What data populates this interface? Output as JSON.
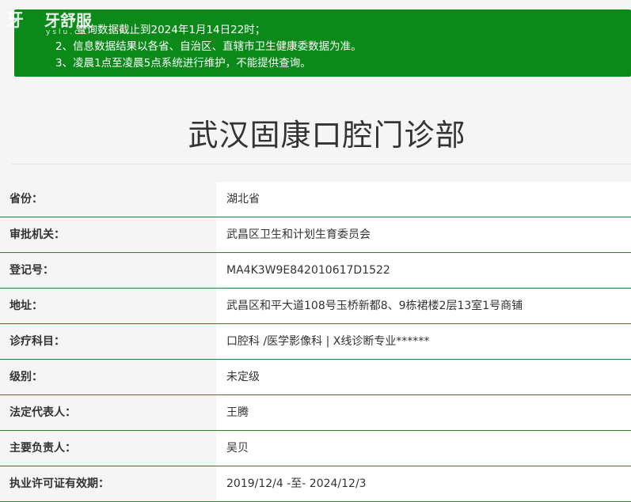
{
  "logo": {
    "mark": "牙",
    "brand": "牙舒服",
    "sub": "yslu.cn"
  },
  "notice": {
    "lines": [
      "查询数据截止到2024年1月14日22时；",
      "2、信息数据结果以各省、自治区、直辖市卫生健康委数据为准。",
      "3、凌晨1点至凌晨5点系统进行维护，不能提供查询。"
    ]
  },
  "title": "武汉固康口腔门诊部",
  "rows": [
    {
      "label": "省份：",
      "value": "湖北省"
    },
    {
      "label": "审批机关：",
      "value": "武昌区卫生和计划生育委员会"
    },
    {
      "label": "登记号：",
      "value": "MA4K3W9E842010617D1522"
    },
    {
      "label": "地址：",
      "value": "武昌区和平大道108号玉桥新都8、9栋裙楼2层13室1号商铺"
    },
    {
      "label": "诊疗科目：",
      "value": "口腔科 /医学影像科  |  X线诊断专业******"
    },
    {
      "label": "级别：",
      "value": "未定级"
    },
    {
      "label": "法定代表人：",
      "value": "王腾"
    },
    {
      "label": "主要负责人：",
      "value": "吴贝"
    },
    {
      "label": "执业许可证有效期：",
      "value": "2019/12/4 -至- 2024/12/3"
    }
  ]
}
